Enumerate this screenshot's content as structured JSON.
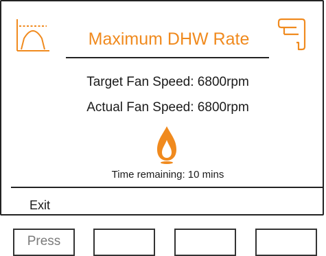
{
  "screen": {
    "title": "Maximum DHW Rate",
    "mode_icon": "max-rate-arc-icon",
    "tap_icon": "hot-water-tap-icon",
    "target_fan_speed": "Target Fan Speed: 6800rpm",
    "actual_fan_speed": "Actual Fan Speed: 6800rpm",
    "flame_icon": "flame-icon",
    "time_remaining": "Time remaining: 10 mins",
    "footer": {
      "exit_label": "Exit"
    }
  },
  "softkeys": [
    {
      "label": "Press"
    },
    {
      "label": ""
    },
    {
      "label": ""
    },
    {
      "label": ""
    }
  ],
  "colors": {
    "accent": "#f08a1e",
    "text": "#1a1a1a",
    "rule": "#222222",
    "softkey_label": "#7a7a7a"
  }
}
